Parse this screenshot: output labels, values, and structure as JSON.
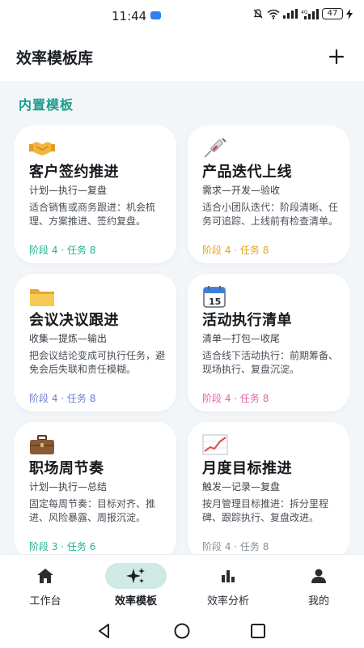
{
  "status_bar": {
    "time": "11:44",
    "battery": "47"
  },
  "header": {
    "title": "效率模板库",
    "add_label": "+"
  },
  "section": {
    "title": "内置模板"
  },
  "cards": [
    {
      "title": "客户签约推进",
      "flow": "计划—执行—复盘",
      "desc": "适合销售或商务跟进：机会梳理、方案推进、签约复盘。",
      "meta": "阶段 4 · 任务 8",
      "meta_color": "#22b38f",
      "icon": "handshake-icon"
    },
    {
      "title": "产品迭代上线",
      "flow": "需求—开发—验收",
      "desc": "适合小团队迭代：阶段清晰、任务可追踪、上线前有检查清单。",
      "meta": "阶段 4 · 任务 8",
      "meta_color": "#e2a81b",
      "icon": "syringe-icon"
    },
    {
      "title": "会议决议跟进",
      "flow": "收集—提炼—输出",
      "desc": "把会议结论变成可执行任务，避免会后失联和责任模糊。",
      "meta": "阶段 4 · 任务 8",
      "meta_color": "#6f7fd1",
      "icon": "folder-icon"
    },
    {
      "title": "活动执行清单",
      "flow": "清单—打包—收尾",
      "desc": "适合线下活动执行：前期筹备、现场执行、复盘沉淀。",
      "meta": "阶段 4 · 任务 8",
      "meta_color": "#e066a6",
      "icon": "calendar-icon"
    },
    {
      "title": "职场周节奏",
      "flow": "计划—执行—总结",
      "desc": "固定每周节奏：目标对齐、推进、风险暴露、周报沉淀。",
      "meta": "阶段 3 · 任务 6",
      "meta_color": "#22b38f",
      "icon": "briefcase-icon"
    },
    {
      "title": "月度目标推进",
      "flow": "触发—记录—复盘",
      "desc": "按月管理目标推进：拆分里程碑、跟踪执行、复盘改进。",
      "meta": "阶段 4 · 任务 8",
      "meta_color": "#8a8f97",
      "icon": "chart-up-icon"
    }
  ],
  "nav": [
    {
      "label": "工作台",
      "icon": "home-icon"
    },
    {
      "label": "效率模板",
      "icon": "sparkle-icon",
      "active": true
    },
    {
      "label": "效率分析",
      "icon": "bar-chart-icon"
    },
    {
      "label": "我的",
      "icon": "person-icon"
    }
  ],
  "colors": {
    "accent": "#1a9e8c",
    "active_pill": "#cfe9e4",
    "background": "#f3f6f9"
  }
}
